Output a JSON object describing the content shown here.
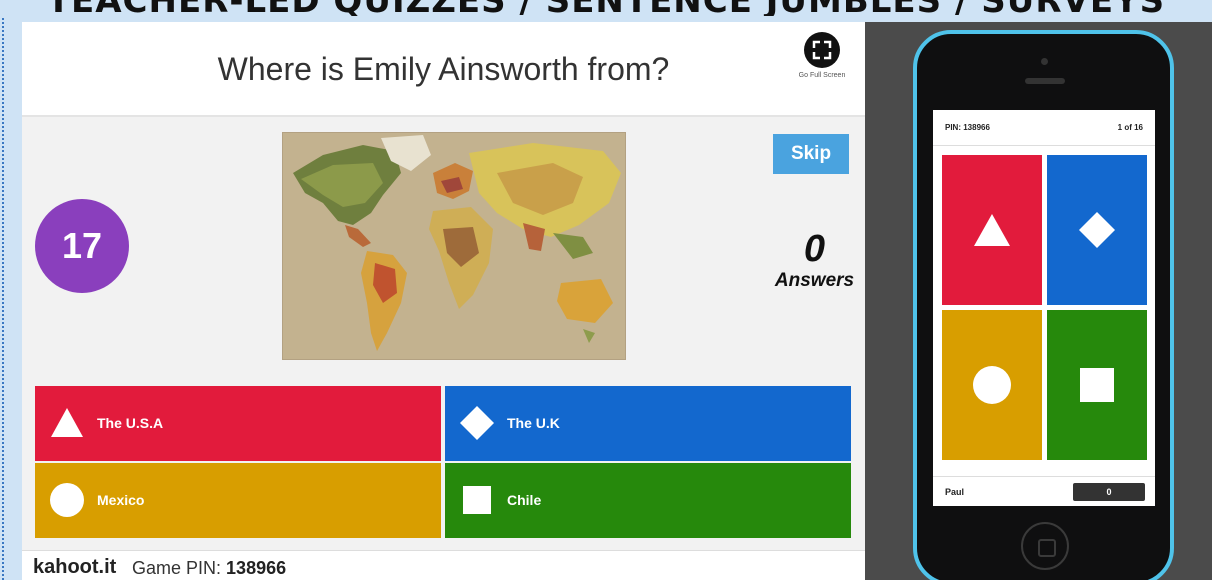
{
  "banner": {
    "text": "TEACHER-LED QUIZZES / SENTENCE JUMBLES / SURVEYS"
  },
  "host": {
    "question": "Where is Emily Ainsworth from?",
    "fullscreen_label": "Go Full Screen",
    "fullscreen_icon": "expand-icon",
    "timer": "17",
    "skip_label": "Skip",
    "answers_count": "0",
    "answers_label": "Answers",
    "options": [
      {
        "label": "The U.S.A",
        "shape": "triangle",
        "color": "#e21b3c"
      },
      {
        "label": "The U.K",
        "shape": "diamond",
        "color": "#1368ce"
      },
      {
        "label": "Mexico",
        "shape": "circle",
        "color": "#d89e00"
      },
      {
        "label": "Chile",
        "shape": "square",
        "color": "#26890c"
      }
    ],
    "footer": {
      "site": "kahoot.it",
      "pin_label": "Game PIN:",
      "pin_value": "138966"
    }
  },
  "phone": {
    "pin_text": "PIN: 138966",
    "progress": "1 of 16",
    "player_name": "Paul",
    "score": "0"
  },
  "colors": {
    "red": "#e21b3c",
    "blue": "#1368ce",
    "yellow": "#d89e00",
    "green": "#26890c",
    "timer": "#8a3fbd",
    "skip": "#4aa3df",
    "phone_frame": "#4fc3ea"
  }
}
